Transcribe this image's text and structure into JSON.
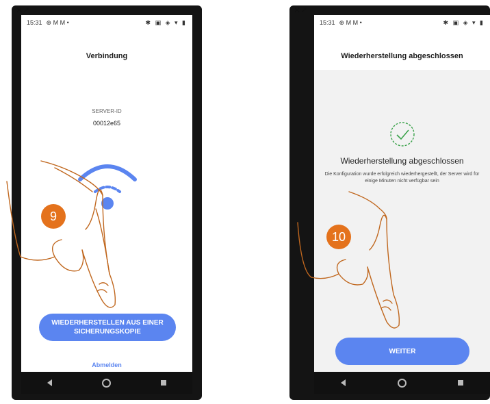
{
  "left_phone": {
    "corner_icons": "✕↗",
    "status_time": "15:31",
    "status_left_icons": "⊕ M M •",
    "status_right_icons": "✱ ▣ ◈ ▾ ▮",
    "title": "Verbindung",
    "server_label": "SERVER-ID",
    "server_id": "00012e65",
    "restore_button": "WIEDERHERSTELLEN AUS EINER SICHERUNGSKOPIE",
    "logout_link": "Abmelden",
    "step_number": "9"
  },
  "right_phone": {
    "corner_icons": "✕↗",
    "status_time": "15:31",
    "status_left_icons": "⊕ M M •",
    "status_right_icons": "✱ ▣ ◈ ▾ ▮",
    "title": "Wiederherstellung abgeschlossen",
    "success_heading": "Wiederherstellung abgeschlossen",
    "success_message": "Die Konfiguration wurde erfolgreich wiederhergestellt, der Server wird für einige Minuten nicht verfügbar sein",
    "continue_button": "WEITER",
    "step_number": "10"
  },
  "colors": {
    "accent_blue": "#5b85f0",
    "step_orange": "#e4721c",
    "success_green": "#3aa24a"
  }
}
